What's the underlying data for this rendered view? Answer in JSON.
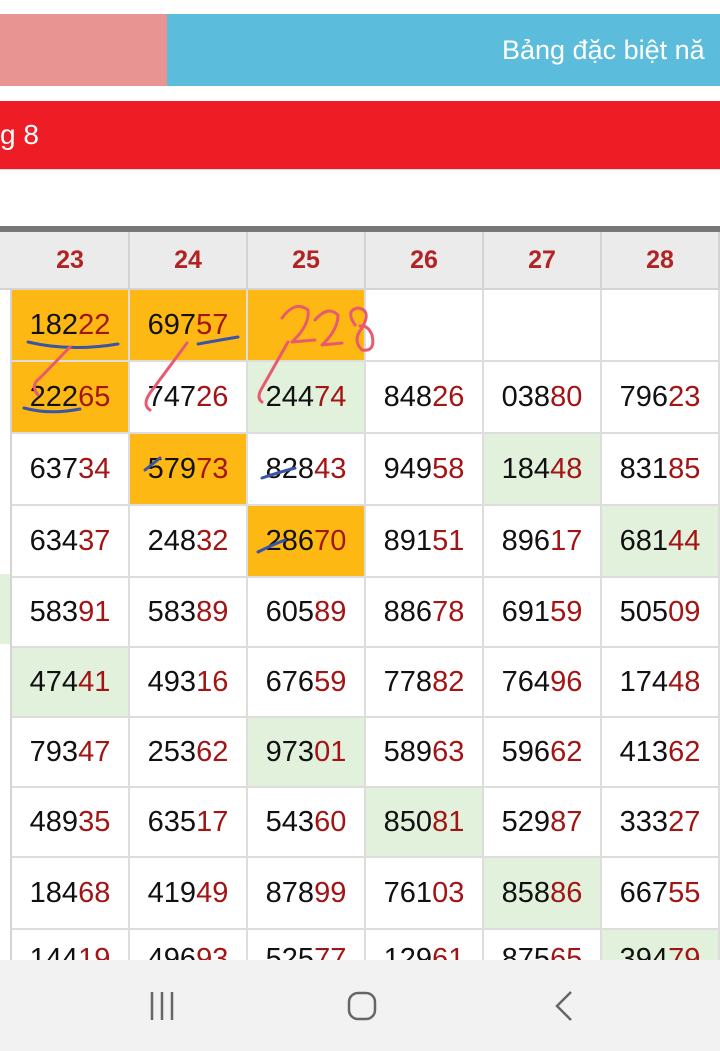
{
  "tabs": {
    "right_label": "Bảng đặc biệt nă"
  },
  "banner": {
    "text": "g 8"
  },
  "table": {
    "columns": [
      {
        "day": "23",
        "cells": [
          {
            "head": "182",
            "tail": "22",
            "hl": "orange"
          },
          {
            "head": "222",
            "tail": "65",
            "hl": "orange"
          },
          {
            "head": "637",
            "tail": "34",
            "hl": ""
          },
          {
            "head": "634",
            "tail": "37",
            "hl": ""
          },
          {
            "head": "583",
            "tail": "91",
            "hl": ""
          },
          {
            "head": "474",
            "tail": "41",
            "hl": "green"
          },
          {
            "head": "793",
            "tail": "47",
            "hl": ""
          },
          {
            "head": "489",
            "tail": "35",
            "hl": ""
          },
          {
            "head": "184",
            "tail": "68",
            "hl": ""
          },
          {
            "head": "144",
            "tail": "19",
            "hl": ""
          }
        ]
      },
      {
        "day": "24",
        "cells": [
          {
            "head": "697",
            "tail": "57",
            "hl": "orange"
          },
          {
            "head": "747",
            "tail": "26",
            "hl": ""
          },
          {
            "head": "579",
            "tail": "73",
            "hl": "orange"
          },
          {
            "head": "248",
            "tail": "32",
            "hl": ""
          },
          {
            "head": "583",
            "tail": "89",
            "hl": ""
          },
          {
            "head": "493",
            "tail": "16",
            "hl": ""
          },
          {
            "head": "253",
            "tail": "62",
            "hl": ""
          },
          {
            "head": "635",
            "tail": "17",
            "hl": ""
          },
          {
            "head": "419",
            "tail": "49",
            "hl": ""
          },
          {
            "head": "496",
            "tail": "93",
            "hl": ""
          }
        ]
      },
      {
        "day": "25",
        "cells": [
          {
            "head": "",
            "tail": "",
            "hl": "orange"
          },
          {
            "head": "244",
            "tail": "74",
            "hl": "green"
          },
          {
            "head": "828",
            "tail": "43",
            "hl": ""
          },
          {
            "head": "286",
            "tail": "70",
            "hl": "orange"
          },
          {
            "head": "605",
            "tail": "89",
            "hl": ""
          },
          {
            "head": "676",
            "tail": "59",
            "hl": ""
          },
          {
            "head": "973",
            "tail": "01",
            "hl": "green"
          },
          {
            "head": "543",
            "tail": "60",
            "hl": ""
          },
          {
            "head": "878",
            "tail": "99",
            "hl": ""
          },
          {
            "head": "525",
            "tail": "77",
            "hl": ""
          }
        ]
      },
      {
        "day": "26",
        "cells": [
          {
            "head": "",
            "tail": "",
            "hl": ""
          },
          {
            "head": "848",
            "tail": "26",
            "hl": ""
          },
          {
            "head": "949",
            "tail": "58",
            "hl": ""
          },
          {
            "head": "891",
            "tail": "51",
            "hl": ""
          },
          {
            "head": "886",
            "tail": "78",
            "hl": ""
          },
          {
            "head": "778",
            "tail": "82",
            "hl": ""
          },
          {
            "head": "589",
            "tail": "63",
            "hl": ""
          },
          {
            "head": "850",
            "tail": "81",
            "hl": "green"
          },
          {
            "head": "761",
            "tail": "03",
            "hl": ""
          },
          {
            "head": "129",
            "tail": "61",
            "hl": ""
          }
        ]
      },
      {
        "day": "27",
        "cells": [
          {
            "head": "",
            "tail": "",
            "hl": ""
          },
          {
            "head": "038",
            "tail": "80",
            "hl": ""
          },
          {
            "head": "184",
            "tail": "48",
            "hl": "green"
          },
          {
            "head": "896",
            "tail": "17",
            "hl": ""
          },
          {
            "head": "691",
            "tail": "59",
            "hl": ""
          },
          {
            "head": "764",
            "tail": "96",
            "hl": ""
          },
          {
            "head": "596",
            "tail": "62",
            "hl": ""
          },
          {
            "head": "529",
            "tail": "87",
            "hl": ""
          },
          {
            "head": "858",
            "tail": "86",
            "hl": "green"
          },
          {
            "head": "875",
            "tail": "65",
            "hl": ""
          }
        ]
      },
      {
        "day": "28",
        "cells": [
          {
            "head": "",
            "tail": "",
            "hl": ""
          },
          {
            "head": "796",
            "tail": "23",
            "hl": ""
          },
          {
            "head": "831",
            "tail": "85",
            "hl": ""
          },
          {
            "head": "681",
            "tail": "44",
            "hl": "green"
          },
          {
            "head": "505",
            "tail": "09",
            "hl": ""
          },
          {
            "head": "174",
            "tail": "48",
            "hl": ""
          },
          {
            "head": "413",
            "tail": "62",
            "hl": ""
          },
          {
            "head": "333",
            "tail": "27",
            "hl": ""
          },
          {
            "head": "667",
            "tail": "55",
            "hl": ""
          },
          {
            "head": "394",
            "tail": "79",
            "hl": "green"
          }
        ]
      }
    ]
  },
  "colors": {
    "orange": "#fdb813",
    "green": "#e1f1dc",
    "tail_red": "#a31515",
    "header_red": "#b22424",
    "banner_red": "#ee1c25",
    "tab_blue": "#5bbcdc",
    "tab_pink": "#e79493"
  },
  "handwriting": {
    "text": "228",
    "color": "#e85a6e"
  },
  "navbar": {
    "icons": [
      "recent-apps-icon",
      "home-icon",
      "back-icon"
    ]
  }
}
